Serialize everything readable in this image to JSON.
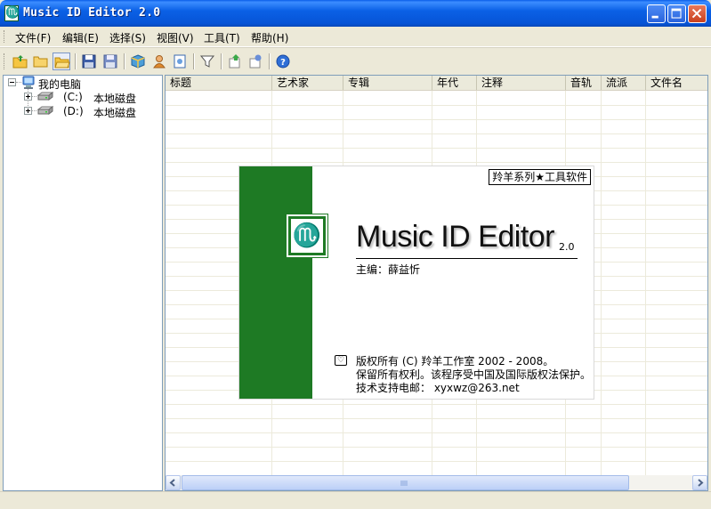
{
  "window": {
    "title": "Music ID Editor 2.0",
    "icon_glyph": "♏",
    "buttons": [
      "minimize",
      "maximize",
      "close"
    ]
  },
  "menu": [
    {
      "label": "文件(F)"
    },
    {
      "label": "编辑(E)"
    },
    {
      "label": "选择(S)"
    },
    {
      "label": "视图(V)"
    },
    {
      "label": "工具(T)"
    },
    {
      "label": "帮助(H)"
    }
  ],
  "toolbar": {
    "icons": [
      "open-folder-icon",
      "folder-icon",
      "open-dir-icon",
      "save-icon",
      "save-all-icon",
      "tag-box-icon",
      "user-icon",
      "document-icon",
      "filter-icon",
      "import-icon",
      "export-icon",
      "help-icon"
    ]
  },
  "tree": {
    "root": {
      "label": "我的电脑",
      "icon": "computer-icon"
    },
    "drives": [
      {
        "letter": "(C:)",
        "label": "本地磁盘",
        "icon": "hard-drive-icon"
      },
      {
        "letter": "(D:)",
        "label": "本地磁盘",
        "icon": "hard-drive-icon"
      }
    ]
  },
  "list": {
    "columns": [
      "标题",
      "艺术家",
      "专辑",
      "年代",
      "注释",
      "音轨",
      "流派",
      "文件名"
    ],
    "rows": []
  },
  "splash": {
    "series": "羚羊系列★工具软件",
    "logo_glyph": "♏",
    "product": "Music ID Editor",
    "version": "2.0",
    "editor": "主编：薛益忻",
    "copyright_mark": "♡",
    "copyright": "版权所有 (C) 羚羊工作室 2002 - 2008。",
    "rights": "保留所有权利。该程序受中国及国际版权法保护。",
    "support": "技术支持电邮： xyxwz@263.net"
  },
  "colors": {
    "splash_green": "#1e7a24",
    "titlebar_blue": "#0b61e6",
    "close_red": "#c9401e"
  }
}
